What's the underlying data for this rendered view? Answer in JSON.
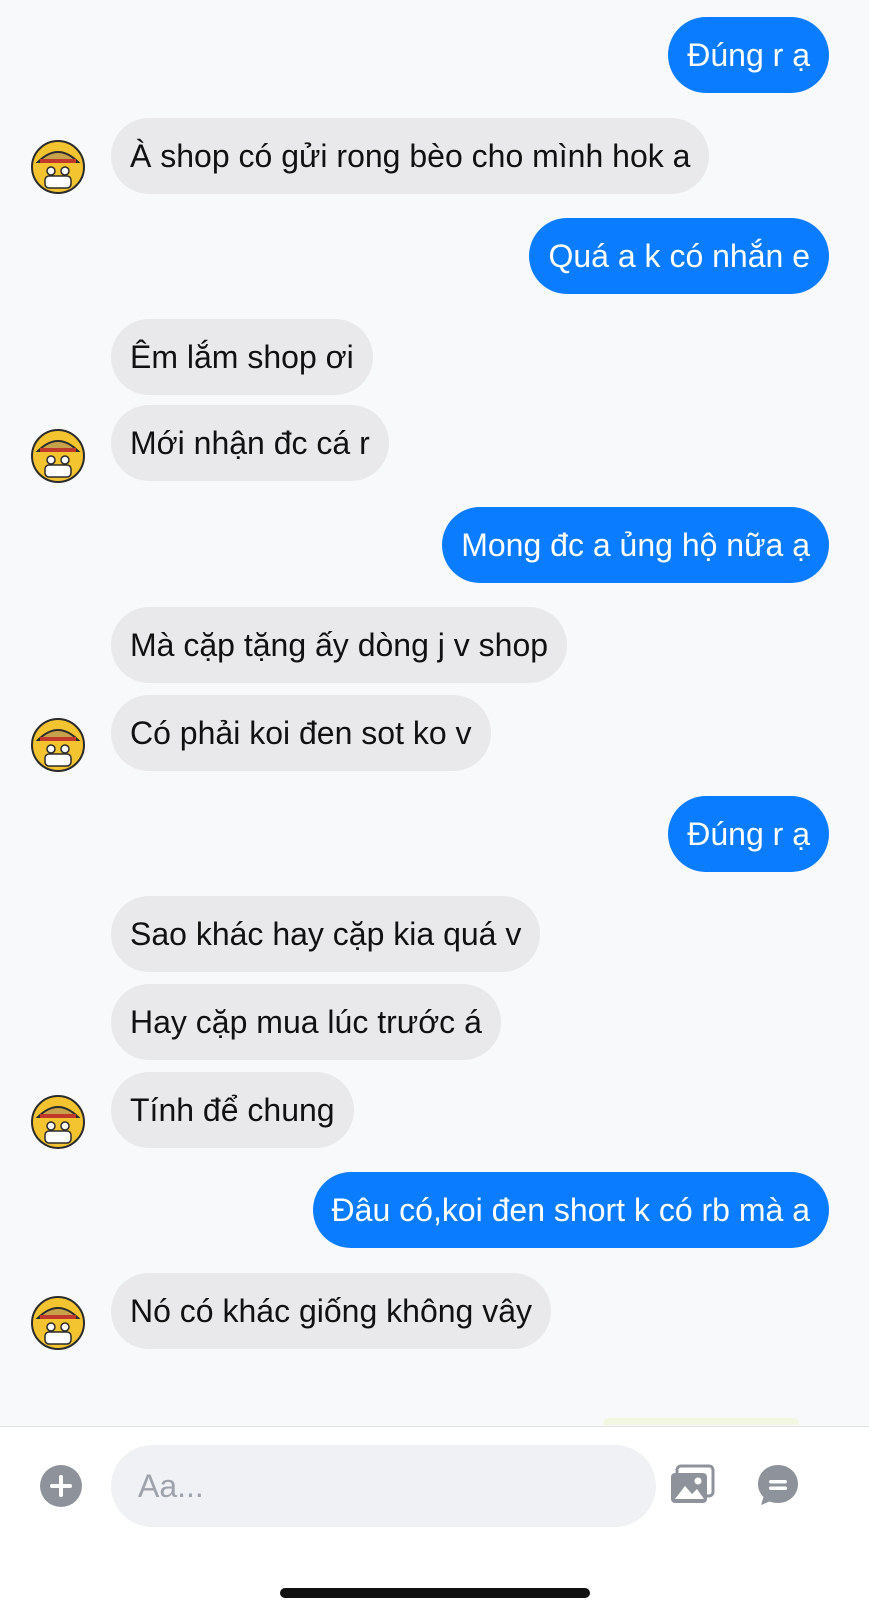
{
  "colors": {
    "outgoing_bubble": "#0a7cff",
    "incoming_bubble": "#e9e9eb",
    "background": "#f8f9fa"
  },
  "messages": [
    {
      "from": "me",
      "text": "Đúng r ạ"
    },
    {
      "from": "them",
      "text": "À shop có gửi rong bèo cho mình hok a",
      "avatar": true
    },
    {
      "from": "me",
      "text": "Quá a k có nhắn e"
    },
    {
      "from": "them",
      "text": "Êm lắm shop ơi"
    },
    {
      "from": "them",
      "text": "Mới nhận đc cá r",
      "avatar": true
    },
    {
      "from": "me",
      "text": "Mong đc a ủng hộ nữa ạ"
    },
    {
      "from": "them",
      "text": "Mà cặp tặng ấy dòng j v shop"
    },
    {
      "from": "them",
      "text": "Có phải koi đen sot ko v",
      "avatar": true
    },
    {
      "from": "me",
      "text": "Đúng r ạ"
    },
    {
      "from": "them",
      "text": "Sao khác hay cặp kia quá v"
    },
    {
      "from": "them",
      "text": "Hay cặp mua lúc trước á"
    },
    {
      "from": "them",
      "text": "Tính để chung",
      "avatar": true
    },
    {
      "from": "me",
      "text": "Đâu có,koi đen short k có rb mà a"
    },
    {
      "from": "them",
      "text": "Nó có khác giống không vây",
      "avatar": true
    }
  ],
  "composer": {
    "placeholder": "Aa...",
    "icons": [
      "plus-circle-icon",
      "gallery-icon",
      "chat-bubble-icon"
    ]
  }
}
